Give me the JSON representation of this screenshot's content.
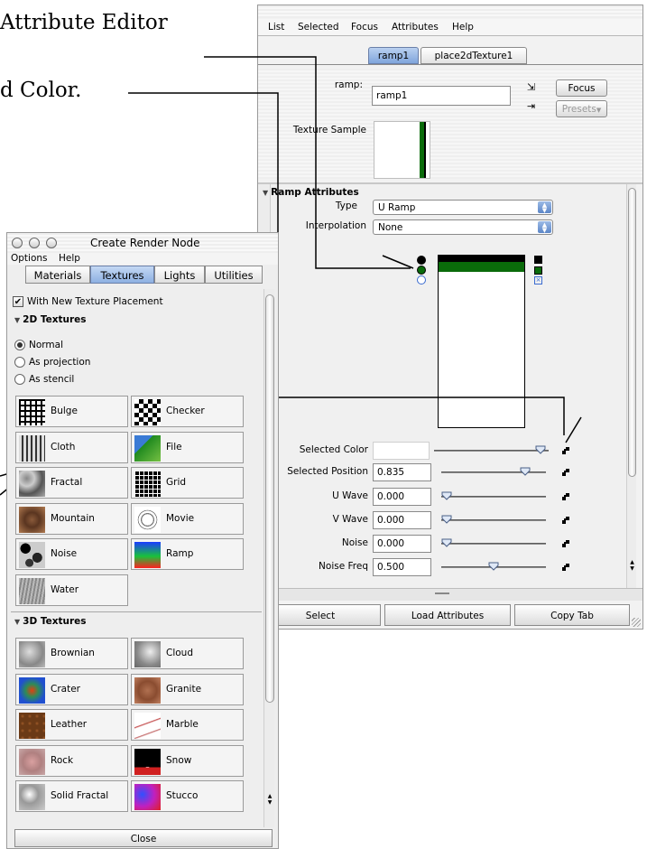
{
  "callouts": {
    "top": "Attribute Editor",
    "color": "d Color."
  },
  "attr_editor": {
    "menu": [
      "List",
      "Selected",
      "Focus",
      "Attributes",
      "Help"
    ],
    "tabs": [
      "ramp1",
      "place2dTexture1"
    ],
    "node_label": "ramp:",
    "node_value": "ramp1",
    "focus_label": "Focus",
    "presets_label": "Presets",
    "texture_sample_label": "Texture Sample",
    "section_title": "Ramp Attributes",
    "type_label": "Type",
    "type_value": "U Ramp",
    "interp_label": "Interpolation",
    "interp_value": "None",
    "params": [
      {
        "label": "Selected Color",
        "value": "",
        "level": 0.97
      },
      {
        "label": "Selected Position",
        "value": "0.835",
        "level": 0.835
      },
      {
        "label": "U Wave",
        "value": "0.000",
        "level": 0.0
      },
      {
        "label": "V Wave",
        "value": "0.000",
        "level": 0.0
      },
      {
        "label": "Noise",
        "value": "0.000",
        "level": 0.0
      },
      {
        "label": "Noise Freq",
        "value": "0.500",
        "level": 0.5
      }
    ],
    "bottom_buttons": [
      "Select",
      "Load Attributes",
      "Copy Tab"
    ],
    "colors": {
      "ramp_green": "#0a6b0a",
      "ramp_black": "#000000"
    }
  },
  "render_node": {
    "title": "Create Render Node",
    "menu": [
      "Options",
      "Help"
    ],
    "tabs": [
      "Materials",
      "Textures",
      "Lights",
      "Utilities"
    ],
    "active_tab": "Textures",
    "placement_checkbox": "With New Texture Placement",
    "section_2d": "2D Textures",
    "radios": [
      "Normal",
      "As projection",
      "As stencil"
    ],
    "textures_2d": [
      {
        "name": "Bulge",
        "icon": "bulge-icon"
      },
      {
        "name": "Checker",
        "icon": "checker-icon"
      },
      {
        "name": "Cloth",
        "icon": "cloth-icon"
      },
      {
        "name": "File",
        "icon": "file-icon"
      },
      {
        "name": "Fractal",
        "icon": "fractal-icon"
      },
      {
        "name": "Grid",
        "icon": "grid-icon"
      },
      {
        "name": "Mountain",
        "icon": "mountain-icon"
      },
      {
        "name": "Movie",
        "icon": "movie-icon"
      },
      {
        "name": "Noise",
        "icon": "noise-icon"
      },
      {
        "name": "Ramp",
        "icon": "ramp-icon"
      },
      {
        "name": "Water",
        "icon": "water-icon"
      }
    ],
    "section_3d": "3D Textures",
    "textures_3d": [
      {
        "name": "Brownian",
        "icon": "brownian-icon"
      },
      {
        "name": "Cloud",
        "icon": "cloud-icon"
      },
      {
        "name": "Crater",
        "icon": "crater-icon"
      },
      {
        "name": "Granite",
        "icon": "granite-icon"
      },
      {
        "name": "Leather",
        "icon": "leather-icon"
      },
      {
        "name": "Marble",
        "icon": "marble-icon"
      },
      {
        "name": "Rock",
        "icon": "rock-icon"
      },
      {
        "name": "Snow",
        "icon": "snow-icon"
      },
      {
        "name": "Solid Fractal",
        "icon": "solid-fractal-icon"
      },
      {
        "name": "Stucco",
        "icon": "stucco-icon"
      }
    ],
    "close_label": "Close"
  }
}
